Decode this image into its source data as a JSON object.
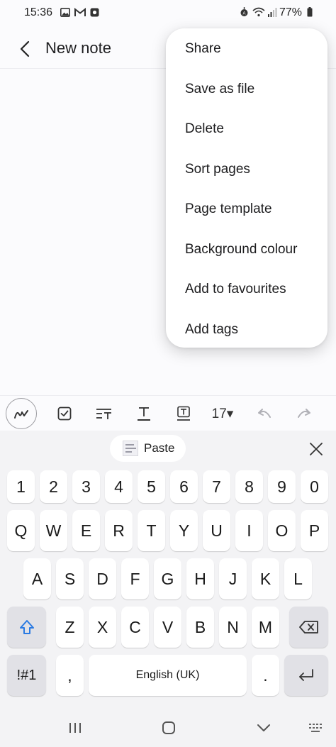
{
  "status_bar": {
    "time": "15:36",
    "battery": "77%",
    "icons": [
      "gallery-icon",
      "gmail-icon",
      "app-icon",
      "alarm-icon",
      "wifi-icon",
      "signal-icon",
      "battery-icon"
    ]
  },
  "header": {
    "title": "New note"
  },
  "menu": {
    "items": [
      "Share",
      "Save as file",
      "Delete",
      "Sort pages",
      "Page template",
      "Background colour",
      "Add to favourites",
      "Add tags"
    ]
  },
  "toolbar": {
    "font_size": "17▾",
    "icons": [
      "pen-icon",
      "checkbox-icon",
      "text-style-icon",
      "text-format-icon",
      "text-box-icon",
      "undo-icon",
      "redo-icon"
    ]
  },
  "keyboard": {
    "paste_label": "Paste",
    "row_numbers": [
      "1",
      "2",
      "3",
      "4",
      "5",
      "6",
      "7",
      "8",
      "9",
      "0"
    ],
    "row_1": [
      "Q",
      "W",
      "E",
      "R",
      "T",
      "Y",
      "U",
      "I",
      "O",
      "P"
    ],
    "row_2": [
      "A",
      "S",
      "D",
      "F",
      "G",
      "H",
      "J",
      "K",
      "L"
    ],
    "row_3": [
      "Z",
      "X",
      "C",
      "V",
      "B",
      "N",
      "M"
    ],
    "symbols_label": "!#1",
    "comma_label": ",",
    "space_label": "English (UK)",
    "period_label": "."
  },
  "colors": {
    "accent": "#2a7ae2",
    "background": "#fbfbfd",
    "keyboard_bg": "#f3f3f5",
    "key_dark": "#e1e1e6"
  }
}
